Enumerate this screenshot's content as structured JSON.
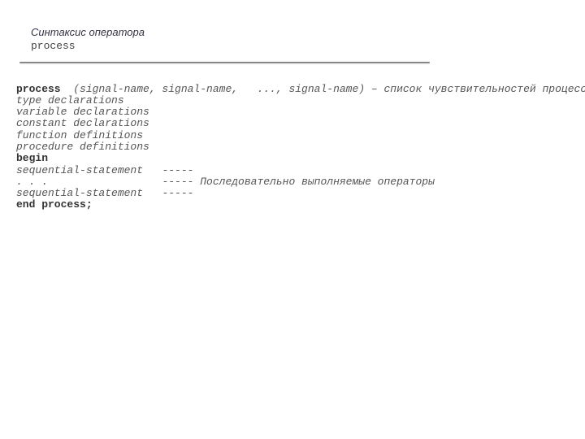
{
  "title": {
    "line1": "Синтаксис оператора",
    "line2": "process"
  },
  "code": {
    "l1_kw": "process",
    "l1_rest": "  (signal-name, signal-name,   ..., signal-name) – список чувствительностей процесса",
    "l2": "type declarations",
    "l3": "variable declarations",
    "l4": "constant declarations",
    "l5": "function definitions",
    "l6": "procedure definitions",
    "l7_kw": "begin",
    "l8_a": "sequential-statement   ",
    "l8_b": "-----",
    "l9_a": ". . .                  ",
    "l9_b": "----- Последовательно выполняемые операторы",
    "l10_a": "sequential-statement   ",
    "l10_b": "-----",
    "l11_kw": "end process;"
  }
}
